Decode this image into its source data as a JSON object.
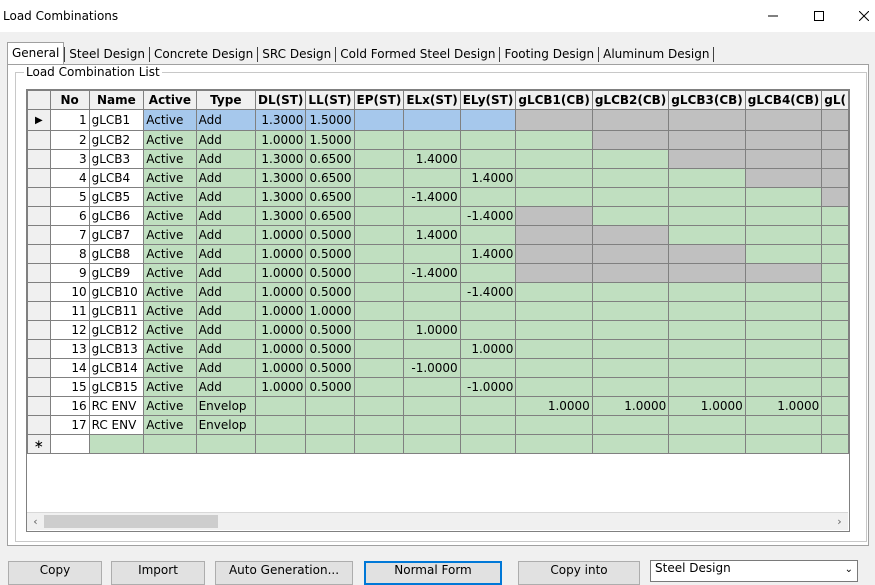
{
  "window": {
    "title": "Load Combinations"
  },
  "tabs": [
    "General",
    "Steel Design",
    "Concrete Design",
    "SRC Design",
    "Cold Formed Steel Design",
    "Footing Design",
    "Aluminum Design"
  ],
  "group_label": "Load Combination List",
  "columns": [
    "No",
    "Name",
    "Active",
    "Type",
    "DL(ST)",
    "LL(ST)",
    "EP(ST)",
    "ELx(ST)",
    "ELy(ST)",
    "gLCB1(CB)",
    "gLCB2(CB)",
    "gLCB3(CB)",
    "gLCB4(CB)",
    "gL("
  ],
  "rows": [
    {
      "no": "1",
      "name": "gLCB1",
      "active": "Active",
      "type": "Add",
      "dl": "1.3000",
      "ll": "1.5000",
      "ep": "",
      "elx": "",
      "ely": "",
      "c1": "",
      "c2": "",
      "c3": "",
      "c4": ""
    },
    {
      "no": "2",
      "name": "gLCB2",
      "active": "Active",
      "type": "Add",
      "dl": "1.0000",
      "ll": "1.5000",
      "ep": "",
      "elx": "",
      "ely": "",
      "c1": "",
      "c2": "",
      "c3": "",
      "c4": ""
    },
    {
      "no": "3",
      "name": "gLCB3",
      "active": "Active",
      "type": "Add",
      "dl": "1.3000",
      "ll": "0.6500",
      "ep": "",
      "elx": "1.4000",
      "ely": "",
      "c1": "",
      "c2": "",
      "c3": "",
      "c4": ""
    },
    {
      "no": "4",
      "name": "gLCB4",
      "active": "Active",
      "type": "Add",
      "dl": "1.3000",
      "ll": "0.6500",
      "ep": "",
      "elx": "",
      "ely": "1.4000",
      "c1": "",
      "c2": "",
      "c3": "",
      "c4": ""
    },
    {
      "no": "5",
      "name": "gLCB5",
      "active": "Active",
      "type": "Add",
      "dl": "1.3000",
      "ll": "0.6500",
      "ep": "",
      "elx": "-1.4000",
      "ely": "",
      "c1": "",
      "c2": "",
      "c3": "",
      "c4": ""
    },
    {
      "no": "6",
      "name": "gLCB6",
      "active": "Active",
      "type": "Add",
      "dl": "1.3000",
      "ll": "0.6500",
      "ep": "",
      "elx": "",
      "ely": "-1.4000",
      "c1": "",
      "c2": "",
      "c3": "",
      "c4": ""
    },
    {
      "no": "7",
      "name": "gLCB7",
      "active": "Active",
      "type": "Add",
      "dl": "1.0000",
      "ll": "0.5000",
      "ep": "",
      "elx": "1.4000",
      "ely": "",
      "c1": "",
      "c2": "",
      "c3": "",
      "c4": ""
    },
    {
      "no": "8",
      "name": "gLCB8",
      "active": "Active",
      "type": "Add",
      "dl": "1.0000",
      "ll": "0.5000",
      "ep": "",
      "elx": "",
      "ely": "1.4000",
      "c1": "",
      "c2": "",
      "c3": "",
      "c4": ""
    },
    {
      "no": "9",
      "name": "gLCB9",
      "active": "Active",
      "type": "Add",
      "dl": "1.0000",
      "ll": "0.5000",
      "ep": "",
      "elx": "-1.4000",
      "ely": "",
      "c1": "",
      "c2": "",
      "c3": "",
      "c4": ""
    },
    {
      "no": "10",
      "name": "gLCB10",
      "active": "Active",
      "type": "Add",
      "dl": "1.0000",
      "ll": "0.5000",
      "ep": "",
      "elx": "",
      "ely": "-1.4000",
      "c1": "",
      "c2": "",
      "c3": "",
      "c4": ""
    },
    {
      "no": "11",
      "name": "gLCB11",
      "active": "Active",
      "type": "Add",
      "dl": "1.0000",
      "ll": "1.0000",
      "ep": "",
      "elx": "",
      "ely": "",
      "c1": "",
      "c2": "",
      "c3": "",
      "c4": ""
    },
    {
      "no": "12",
      "name": "gLCB12",
      "active": "Active",
      "type": "Add",
      "dl": "1.0000",
      "ll": "0.5000",
      "ep": "",
      "elx": "1.0000",
      "ely": "",
      "c1": "",
      "c2": "",
      "c3": "",
      "c4": ""
    },
    {
      "no": "13",
      "name": "gLCB13",
      "active": "Active",
      "type": "Add",
      "dl": "1.0000",
      "ll": "0.5000",
      "ep": "",
      "elx": "",
      "ely": "1.0000",
      "c1": "",
      "c2": "",
      "c3": "",
      "c4": ""
    },
    {
      "no": "14",
      "name": "gLCB14",
      "active": "Active",
      "type": "Add",
      "dl": "1.0000",
      "ll": "0.5000",
      "ep": "",
      "elx": "-1.0000",
      "ely": "",
      "c1": "",
      "c2": "",
      "c3": "",
      "c4": ""
    },
    {
      "no": "15",
      "name": "gLCB15",
      "active": "Active",
      "type": "Add",
      "dl": "1.0000",
      "ll": "0.5000",
      "ep": "",
      "elx": "",
      "ely": "-1.0000",
      "c1": "",
      "c2": "",
      "c3": "",
      "c4": ""
    },
    {
      "no": "16",
      "name": "RC ENV",
      "active": "Active",
      "type": "Envelop",
      "dl": "",
      "ll": "",
      "ep": "",
      "elx": "",
      "ely": "",
      "c1": "1.0000",
      "c2": "1.0000",
      "c3": "1.0000",
      "c4": "1.0000"
    },
    {
      "no": "17",
      "name": "RC ENV",
      "active": "Active",
      "type": "Envelop",
      "dl": "",
      "ll": "",
      "ep": "",
      "elx": "",
      "ely": "",
      "c1": "",
      "c2": "",
      "c3": "",
      "c4": ""
    }
  ],
  "buttons": {
    "copy": "Copy",
    "import": "Import",
    "auto_generation": "Auto Generation...",
    "normal_form": "Normal Form",
    "copy_into": "Copy into"
  },
  "design_select": {
    "value": "Steel Design"
  },
  "colors": {
    "cell_green": "#c0dfc0",
    "cell_selected": "#a6c8ec",
    "cell_disabled": "#c0c0c0"
  }
}
